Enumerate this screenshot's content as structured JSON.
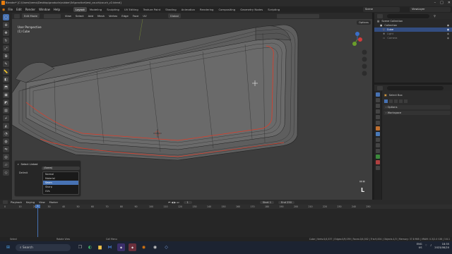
{
  "window": {
    "title": "Blender* [C:\\Users\\hemo\\Desktop\\products\\rubber\\3d\\practice\\test_couch\\couch_v2.blend]"
  },
  "menu": {
    "items": [
      "File",
      "Edit",
      "Render",
      "Window",
      "Help"
    ],
    "workspaces": [
      "Layout",
      "Modeling",
      "Sculpting",
      "UV Editing",
      "Texture Paint",
      "Shading",
      "Animation",
      "Rendering",
      "Compositing",
      "Geometry Nodes",
      "Scripting"
    ],
    "active_workspace": "Layout",
    "scene_label": "Scene",
    "viewlayer_label": "ViewLayer"
  },
  "viewport_header": {
    "mode": "Edit Mode",
    "menus": [
      "View",
      "Select",
      "Add",
      "Mesh",
      "Vertex",
      "Edge",
      "Face",
      "UV"
    ],
    "orientation": "Global",
    "options": "Options"
  },
  "viewport": {
    "view_name": "User Perspective",
    "object_name": "(1) Cube",
    "overlay_letter": "L"
  },
  "last_operator": {
    "title": "Select Linked",
    "delimit_label": "Delimit",
    "delimit_value": "(Seam)",
    "options": [
      "Normal",
      "Material",
      "Seam",
      "Sharp",
      "UVs"
    ],
    "selected_option": "Seam"
  },
  "outliner": {
    "title": "Scene Collection",
    "items": [
      {
        "label": "Scene Collection",
        "selected": false
      },
      {
        "label": "Collection",
        "selected": false
      },
      {
        "label": "Cube",
        "selected": true
      },
      {
        "label": "Light",
        "selected": false
      },
      {
        "label": "Camera",
        "selected": false
      }
    ]
  },
  "properties": {
    "active_tool": "Select Box",
    "sections": [
      "Options",
      "Workspace"
    ]
  },
  "timeline": {
    "menus": [
      "Playback",
      "Keying",
      "View",
      "Marker"
    ],
    "current_frame": "1",
    "start_label": "Start",
    "start_value": "1",
    "end_label": "End",
    "end_value": "250",
    "ticks": [
      "0",
      "10",
      "20",
      "30",
      "40",
      "50",
      "60",
      "70",
      "80",
      "90",
      "100",
      "110",
      "120",
      "130",
      "140",
      "150",
      "160",
      "170",
      "180",
      "190",
      "200",
      "210",
      "220",
      "230",
      "240",
      "250"
    ]
  },
  "status": {
    "left": "Select",
    "mid1": "Rotate View",
    "mid2": "Call Menu",
    "right": "Cube | Verts:0/4,537 | Edges:0/9,039 | Faces:0/4,502 | Tris:9,004 | Objects:1/3 | Memory: 37.8 MiB | VRAM: 0.3/2.0 GiB | 3.6.1"
  },
  "taskbar": {
    "search_placeholder": "Search",
    "lang": "ENG",
    "lang2": "US",
    "time": "18:35",
    "date": "2023/08/20"
  },
  "colors": {
    "accent": "#4772b3",
    "seam": "#e03c28",
    "viewport_bg": "#3d3d3d"
  }
}
